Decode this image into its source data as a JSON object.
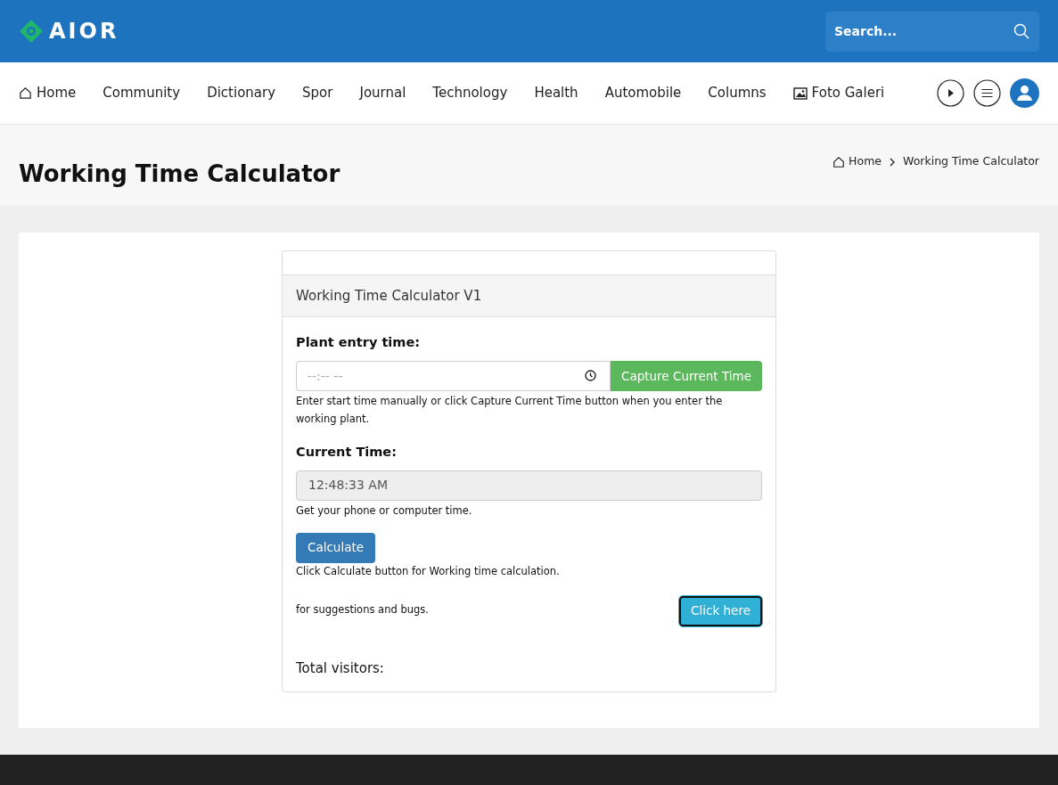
{
  "header": {
    "logo": "AIOR",
    "search": {
      "placeholder": "Search..."
    }
  },
  "nav": {
    "items": [
      {
        "label": "Home",
        "kind": "home"
      },
      {
        "label": "Community",
        "kind": "plain"
      },
      {
        "label": "Dictionary",
        "kind": "plain"
      },
      {
        "label": "Spor",
        "kind": "plain"
      },
      {
        "label": "Journal",
        "kind": "plain"
      },
      {
        "label": "Technology",
        "kind": "plain"
      },
      {
        "label": "Health",
        "kind": "plain"
      },
      {
        "label": "Automobile",
        "kind": "plain"
      },
      {
        "label": "Columns",
        "kind": "plain"
      },
      {
        "label": "Foto Galeri",
        "kind": "gallery"
      }
    ]
  },
  "page_title": "Working Time Calculator",
  "breadcrumb": [
    "Home",
    "Working Time Calculator"
  ],
  "calculator": {
    "title": "Working Time Calculator V1",
    "entry_label": "Plant entry time:",
    "entry_placeholder": "--:-- --",
    "capture_button": "Capture Current Time",
    "entry_help": "Enter start time manually or click Capture Current Time button when you enter the working plant.",
    "current_label": "Current Time:",
    "current_value": "12:48:33 AM",
    "current_help": "Get your phone or computer time.",
    "calculate_button": "Calculate",
    "calculate_help": "Click Calculate button for Working time calculation.",
    "feedback_text": "for suggestions and bugs.",
    "feedback_button": "Click here",
    "visitors_label": "Total visitors:"
  }
}
